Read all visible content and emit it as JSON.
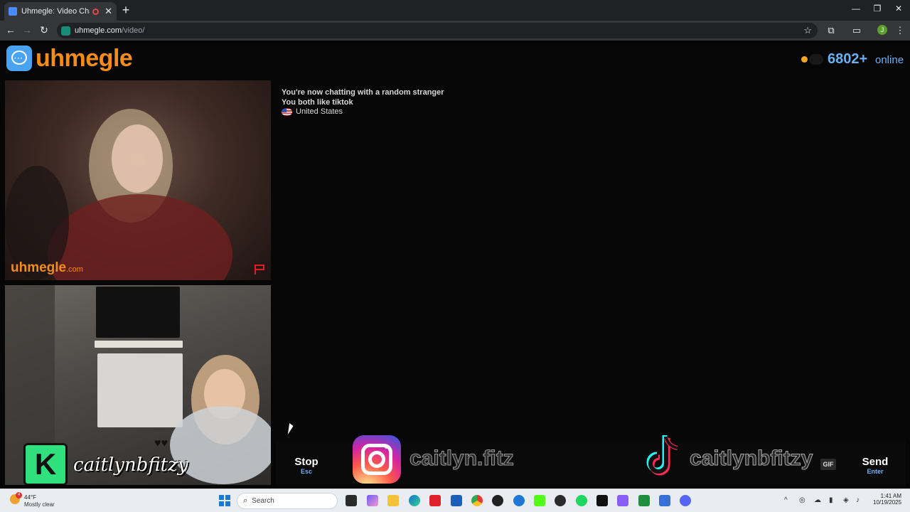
{
  "browser": {
    "tab_title": "Uhmegle: Video Chat | Random",
    "url_host": "uhmegle.com",
    "url_path": "/video/",
    "profile_initial": "J",
    "icons": [
      "back-icon",
      "forward-icon",
      "reload-icon",
      "star-icon",
      "extensions-icon",
      "cast-icon",
      "menu-icon"
    ]
  },
  "site": {
    "logo_text": "uhmegle",
    "online_count": "6802+",
    "online_label": "online",
    "accent_color": "#f28c1b",
    "online_color": "#6ab0f2"
  },
  "stranger_video": {
    "watermark": "uhmegle",
    "watermark_suffix": ".com"
  },
  "self_video": {
    "overlay_badge": "K",
    "overlay_handle": "caitlynbfitzy"
  },
  "chat": {
    "line1": "You're now chatting with a random stranger",
    "line2": "You both like tiktok",
    "country": "United States"
  },
  "controls": {
    "stop_label": "Stop",
    "stop_key": "Esc",
    "send_label": "Send",
    "send_key": "Enter",
    "gif_label": "GIF",
    "instagram_handle": "caitlyn.fitz",
    "tiktok_handle": "caitlynbfitzy"
  },
  "taskbar": {
    "temperature": "44°F",
    "weather": "Mostly clear",
    "weather_badge": "4",
    "search_placeholder": "Search",
    "time": "1:41 AM",
    "date": "10/19/2025"
  }
}
